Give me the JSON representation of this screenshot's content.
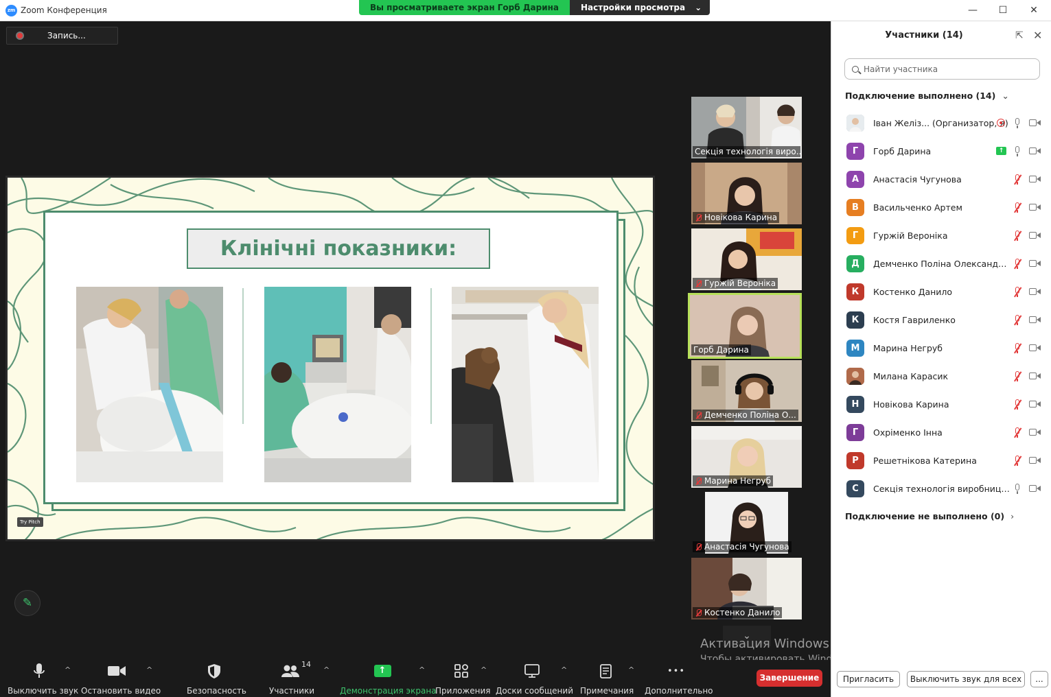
{
  "window": {
    "title": "Zoom Конференция",
    "logo_text": "zm",
    "controls": [
      "—",
      "☐",
      "✕"
    ]
  },
  "share_banner": {
    "viewing_text": "Вы просматриваете экран Горб Дарина",
    "view_settings": "Настройки просмотра",
    "chevron": "⌄"
  },
  "recording": {
    "label": "Запись..."
  },
  "slide": {
    "title": "Клінічні показники:",
    "badge": "Try Pitch",
    "accent_color": "#4d8c6d",
    "background_color": "#fdfbe6"
  },
  "thumbnails": [
    {
      "name": "Секція технологія виро...",
      "muted": false,
      "active": false
    },
    {
      "name": "Новікова Карина",
      "muted": true,
      "active": false
    },
    {
      "name": "Гуржій Вероніка",
      "muted": true,
      "active": false
    },
    {
      "name": "Горб Дарина",
      "muted": false,
      "active": true
    },
    {
      "name": "Демченко Поліна  О...",
      "muted": true,
      "active": false
    },
    {
      "name": "Марина Негруб",
      "muted": true,
      "active": false
    },
    {
      "name": "Анастасія Чугунова",
      "muted": true,
      "active": false
    },
    {
      "name": "Костенко Данило",
      "muted": true,
      "active": false
    }
  ],
  "thumb_scroll_icon": "chevron-down-icon",
  "windows_activation": {
    "title": "Активация Windows",
    "subtitle": "Чтобы активировать Windows, перейдите в раздел \"Параметры\"."
  },
  "toolbar": {
    "mute": "Выключить звук",
    "stop_video": "Остановить видео",
    "security": "Безопасность",
    "participants": "Участники",
    "participants_count": "14",
    "share": "Демонстрация экрана",
    "apps": "Приложения",
    "whiteboards": "Доски сообщений",
    "notes": "Примечания",
    "more": "Дополнительно",
    "end": "Завершение",
    "caret": "^",
    "more_glyph": "•••",
    "share_glyph": "↑"
  },
  "panel": {
    "title": "Участники (14)",
    "search_placeholder": "Найти участника",
    "connected_section": "Подключение выполнено (14)",
    "not_connected_section": "Подключение не выполнено (0)",
    "connected_arrow": "⌄",
    "not_connected_arrow": "›",
    "invite": "Пригласить",
    "mute_all": "Выключить звук для всех",
    "more": "...",
    "popout_glyph": "⇱",
    "close_glyph": "✕",
    "participants": [
      {
        "initial": "",
        "name": "Іван Желіз... (Организатор, я)",
        "color": "#9aa8b5",
        "status": "recording",
        "muted": false,
        "photo": true
      },
      {
        "initial": "Г",
        "name": "Горб Дарина",
        "color": "#8e44ad",
        "status": "sharing",
        "muted": false,
        "photo": false
      },
      {
        "initial": "А",
        "name": "Анастасія Чугунова",
        "color": "#8e44ad",
        "status": "",
        "muted": true,
        "photo": false
      },
      {
        "initial": "В",
        "name": "Васильченко Артем",
        "color": "#e67e22",
        "status": "",
        "muted": true,
        "photo": false
      },
      {
        "initial": "Г",
        "name": "Гуржій Вероніка",
        "color": "#f39c12",
        "status": "",
        "muted": true,
        "photo": false
      },
      {
        "initial": "Д",
        "name": "Демченко Поліна  Олександрів...",
        "color": "#27ae60",
        "status": "",
        "muted": true,
        "photo": false
      },
      {
        "initial": "К",
        "name": "Костенко Данило",
        "color": "#c0392b",
        "status": "",
        "muted": true,
        "photo": false
      },
      {
        "initial": "К",
        "name": "Костя  Гавриленко",
        "color": "#2c3e50",
        "status": "",
        "muted": true,
        "photo": false
      },
      {
        "initial": "М",
        "name": "Марина Негруб",
        "color": "#2e86c1",
        "status": "",
        "muted": true,
        "photo": false
      },
      {
        "initial": "",
        "name": "Милана Карасик",
        "color": "#a0522d",
        "status": "",
        "muted": true,
        "photo": true
      },
      {
        "initial": "Н",
        "name": "Новікова Карина",
        "color": "#34495e",
        "status": "",
        "muted": true,
        "photo": false
      },
      {
        "initial": "Г",
        "name": "Охріменко Інна",
        "color": "#7d3c98",
        "status": "",
        "muted": true,
        "photo": false
      },
      {
        "initial": "Р",
        "name": "Решетнікова Катерина",
        "color": "#c0392b",
        "status": "",
        "muted": true,
        "photo": false
      },
      {
        "initial": "С",
        "name": "Секція технологія виробництва про...",
        "color": "#34495e",
        "status": "",
        "muted": false,
        "photo": false
      }
    ]
  }
}
